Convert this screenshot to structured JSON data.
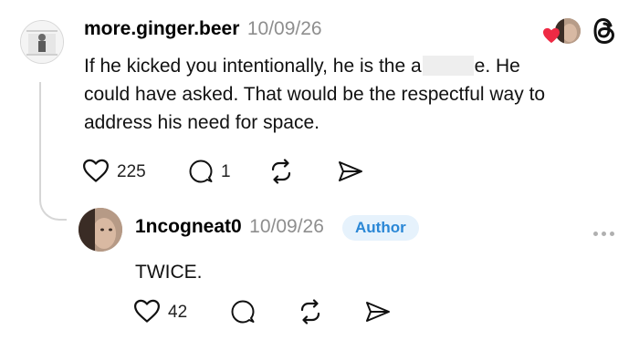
{
  "comment": {
    "username": "more.ginger.beer",
    "date": "10/09/26",
    "text_before": "If he kicked you intentionally, he is the a",
    "text_after": "e. He",
    "line2": "could have asked. That would be the respectful way to",
    "line3": "address his need for space.",
    "likes": "225",
    "replies": "1"
  },
  "reply": {
    "username": "1ncogneat0",
    "date": "10/09/26",
    "badge": "Author",
    "text": "TWICE.",
    "likes": "42"
  },
  "icons": [
    "heart-icon",
    "comment-icon",
    "repost-icon",
    "share-icon",
    "threads-logo-icon",
    "more-icon"
  ],
  "colors": {
    "like_heart": "#ee2a44",
    "badge_text": "#2a87d6",
    "badge_bg": "#e6f2fc",
    "meta": "#8e8e8e"
  }
}
